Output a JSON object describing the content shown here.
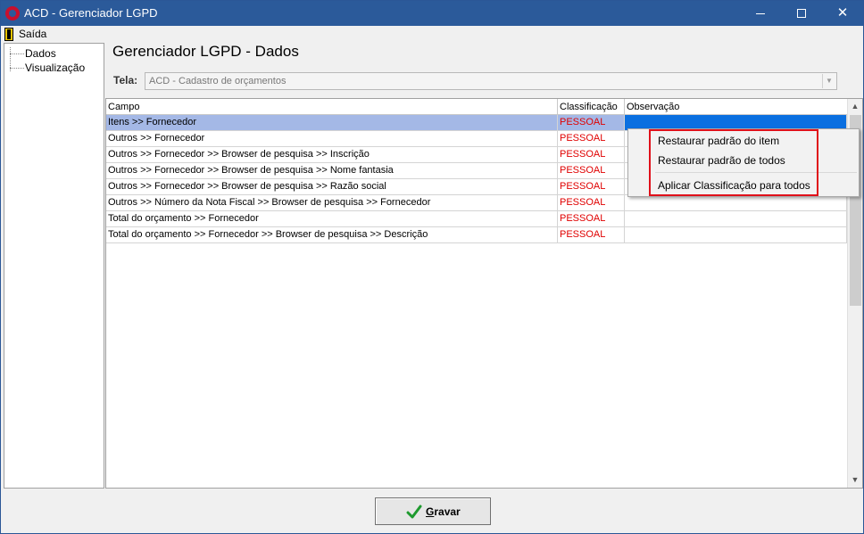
{
  "window": {
    "title": "ACD - Gerenciador LGPD",
    "minimize_glyph": "minimize-icon",
    "maximize_glyph": "maximize-icon",
    "close_glyph": "✕"
  },
  "menu": {
    "saida_label": "Saída",
    "saida_icon": "exit-door-icon"
  },
  "sidebar": {
    "items": [
      {
        "label": "Dados"
      },
      {
        "label": "Visualização"
      }
    ]
  },
  "main": {
    "title": "Gerenciador LGPD - Dados",
    "tela_label": "Tela:",
    "tela_value": "ACD - Cadastro de orçamentos"
  },
  "grid": {
    "columns": [
      "Campo",
      "Classificação",
      "Observação"
    ],
    "rows": [
      {
        "campo": "Itens >> Fornecedor",
        "classificacao": "PESSOAL",
        "observacao": "",
        "selected": true
      },
      {
        "campo": "Outros >> Fornecedor",
        "classificacao": "PESSOAL",
        "observacao": ""
      },
      {
        "campo": "Outros >> Fornecedor >> Browser de pesquisa >> Inscrição",
        "classificacao": "PESSOAL",
        "observacao": ""
      },
      {
        "campo": "Outros >> Fornecedor >> Browser de pesquisa >> Nome fantasia",
        "classificacao": "PESSOAL",
        "observacao": ""
      },
      {
        "campo": "Outros >> Fornecedor >> Browser de pesquisa >> Razão social",
        "classificacao": "PESSOAL",
        "observacao": ""
      },
      {
        "campo": "Outros >> Número da Nota Fiscal >> Browser de pesquisa >> Fornecedor",
        "classificacao": "PESSOAL",
        "observacao": ""
      },
      {
        "campo": "Total do orçamento >> Fornecedor",
        "classificacao": "PESSOAL",
        "observacao": ""
      },
      {
        "campo": "Total do orçamento >> Fornecedor >> Browser de pesquisa >> Descrição",
        "classificacao": "PESSOAL",
        "observacao": ""
      }
    ]
  },
  "context_menu": {
    "items": [
      {
        "label": "Restaurar padrão do item"
      },
      {
        "label": "Restaurar padrão de todos"
      },
      {
        "label": "Aplicar Classificação para todos"
      }
    ]
  },
  "footer": {
    "gravar_label": "Gravar",
    "gravar_icon": "checkmark-icon"
  },
  "colors": {
    "titlebar": "#2b5a9a",
    "classificacao_text": "#e00000",
    "selected_row": "#a4b8e6",
    "selected_cell": "#0a6fe0",
    "highlight_border": "#e0101a"
  }
}
